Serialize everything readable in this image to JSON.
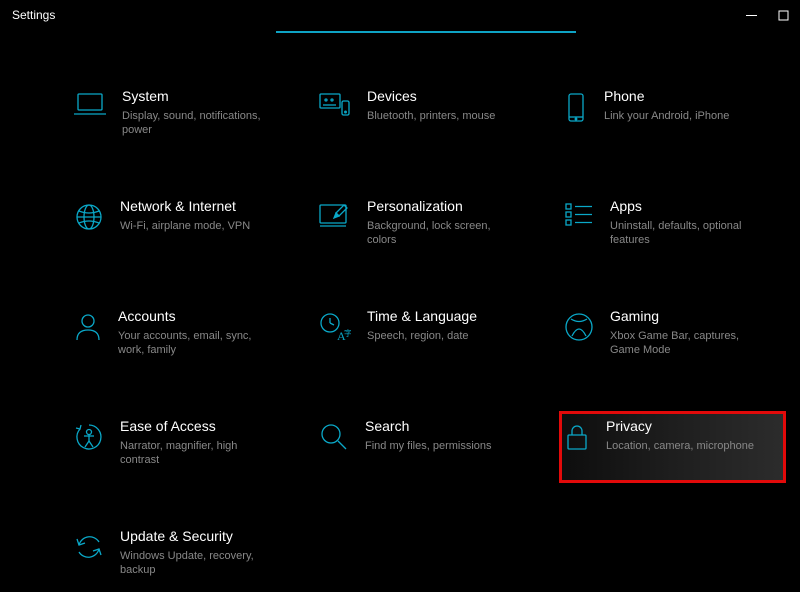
{
  "window": {
    "title": "Settings"
  },
  "accent_color": "#0aa8c8",
  "highlight_border": "#e20a0a",
  "categories": [
    {
      "id": "system",
      "title": "System",
      "desc": "Display, sound, notifications, power"
    },
    {
      "id": "devices",
      "title": "Devices",
      "desc": "Bluetooth, printers, mouse"
    },
    {
      "id": "phone",
      "title": "Phone",
      "desc": "Link your Android, iPhone"
    },
    {
      "id": "network",
      "title": "Network & Internet",
      "desc": "Wi-Fi, airplane mode, VPN"
    },
    {
      "id": "personalize",
      "title": "Personalization",
      "desc": "Background, lock screen, colors"
    },
    {
      "id": "apps",
      "title": "Apps",
      "desc": "Uninstall, defaults, optional features"
    },
    {
      "id": "accounts",
      "title": "Accounts",
      "desc": "Your accounts, email, sync, work, family"
    },
    {
      "id": "time",
      "title": "Time & Language",
      "desc": "Speech, region, date"
    },
    {
      "id": "gaming",
      "title": "Gaming",
      "desc": "Xbox Game Bar, captures, Game Mode"
    },
    {
      "id": "ease",
      "title": "Ease of Access",
      "desc": "Narrator, magnifier, high contrast"
    },
    {
      "id": "search",
      "title": "Search",
      "desc": "Find my files, permissions"
    },
    {
      "id": "privacy",
      "title": "Privacy",
      "desc": "Location, camera, microphone",
      "highlighted": true
    },
    {
      "id": "update",
      "title": "Update & Security",
      "desc": "Windows Update, recovery, backup"
    }
  ]
}
